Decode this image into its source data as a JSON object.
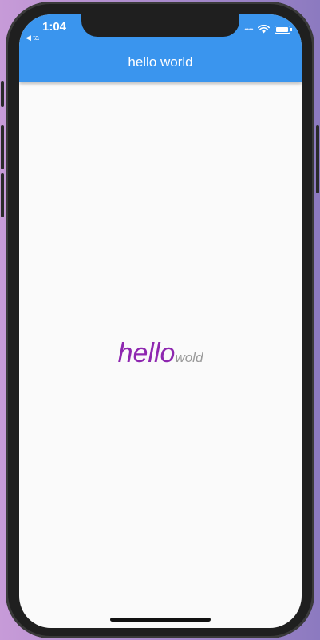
{
  "status_bar": {
    "time": "1:04",
    "back_label": "◀ ta",
    "signal": "••••",
    "wifi_icon": "wifi-icon",
    "battery_icon": "battery-icon"
  },
  "appbar": {
    "title": "hello world",
    "color": "#3a95ee"
  },
  "content": {
    "primary_text": "hello",
    "secondary_text": "wold",
    "primary_color": "#8e27b0",
    "secondary_color": "#9a9a9a"
  }
}
